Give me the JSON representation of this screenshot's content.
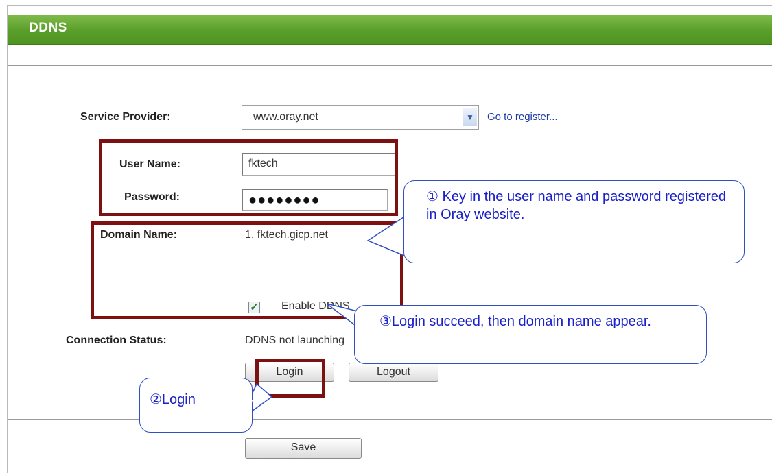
{
  "header": {
    "title": "DDNS"
  },
  "form": {
    "service_provider_label": "Service Provider:",
    "service_provider_value": "www.oray.net",
    "register_link": "Go to register...",
    "user_name_label": "User Name:",
    "user_name_value": "fktech",
    "password_label": "Password:",
    "password_value": "●●●●●●●●",
    "domain_name_label": "Domain Name:",
    "domain_name_value": "1. fktech.gicp.net",
    "enable_ddns_label": "Enable DDNS",
    "enable_ddns_checked": true,
    "connection_status_label": "Connection Status:",
    "connection_status_value": "DDNS not launching"
  },
  "buttons": {
    "login": "Login",
    "logout": "Logout",
    "save": "Save"
  },
  "callouts": {
    "step1": "① Key in the user name and password registered in Oray website.",
    "step2": "②Login",
    "step3": "③Login succeed, then domain name appear."
  },
  "colors": {
    "header_green": "#5a9e2a",
    "highlight_box": "#7d1010",
    "callout_text": "#1a20c8",
    "callout_border": "#3050c0"
  }
}
